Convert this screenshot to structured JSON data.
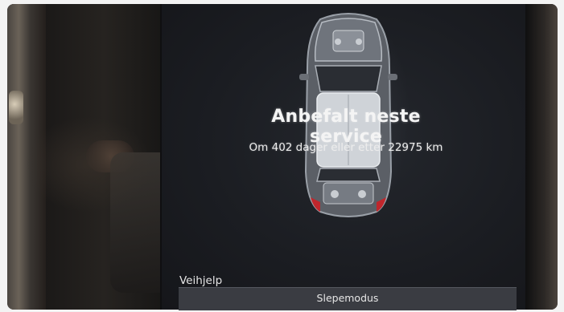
{
  "service": {
    "title": "Anbefalt neste service",
    "detail": "Om 402 dager eller etter 22975 km"
  },
  "section_label": "Veihjelp",
  "button": {
    "label": "Slepemodus"
  },
  "icons": {
    "vehicle": "car-topview-icon"
  }
}
